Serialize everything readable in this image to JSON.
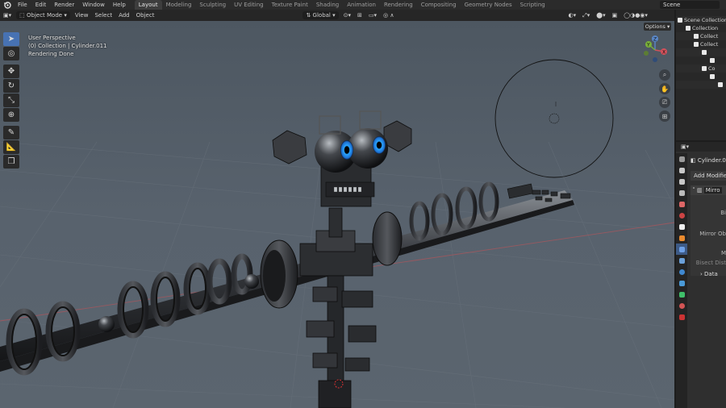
{
  "menu": {
    "items": [
      "File",
      "Edit",
      "Render",
      "Window",
      "Help"
    ],
    "workspaces": [
      "Layout",
      "Modeling",
      "Sculpting",
      "UV Editing",
      "Texture Paint",
      "Shading",
      "Animation",
      "Rendering",
      "Compositing",
      "Geometry Nodes",
      "Scripting"
    ],
    "active_workspace": "Layout",
    "scene_label": "Scene"
  },
  "viewport_header": {
    "mode": "Object Mode",
    "menus": [
      "View",
      "Select",
      "Add",
      "Object"
    ],
    "transform_orientation": "Global",
    "options_label": "Options"
  },
  "overlay": {
    "perspective": "User Perspective",
    "collection_info": "(0) Collection | Cylinder.011",
    "status": "Rendering Done"
  },
  "gizmo": {
    "z": "Z",
    "y": "Y",
    "x": "X"
  },
  "outliner": {
    "rows": [
      "Scene Collection",
      "Collection",
      "Collect",
      "Collect",
      "",
      "",
      "Co",
      "",
      "",
      ""
    ]
  },
  "properties": {
    "object_name": "Cylinder.01",
    "add_modifier": "Add Modifier",
    "modifier_name": "Mirro",
    "fields": [
      "Bi",
      "Mirror Ob",
      "M",
      "Bisect Dist"
    ],
    "data_label": "Data"
  },
  "colors": {
    "accent": "#4772b3",
    "viewport_top": "#4d5761",
    "viewport_bottom": "#5b656f",
    "eye_blue": "#2aa5ff"
  },
  "icons": [
    "blender-logo-icon",
    "cursor-icon",
    "move-icon",
    "rotate-icon",
    "scale-icon",
    "transform-icon",
    "annotate-icon",
    "measure-icon",
    "add-cube-icon",
    "zoom-icon",
    "hand-icon",
    "camera-icon",
    "grid-icon"
  ]
}
